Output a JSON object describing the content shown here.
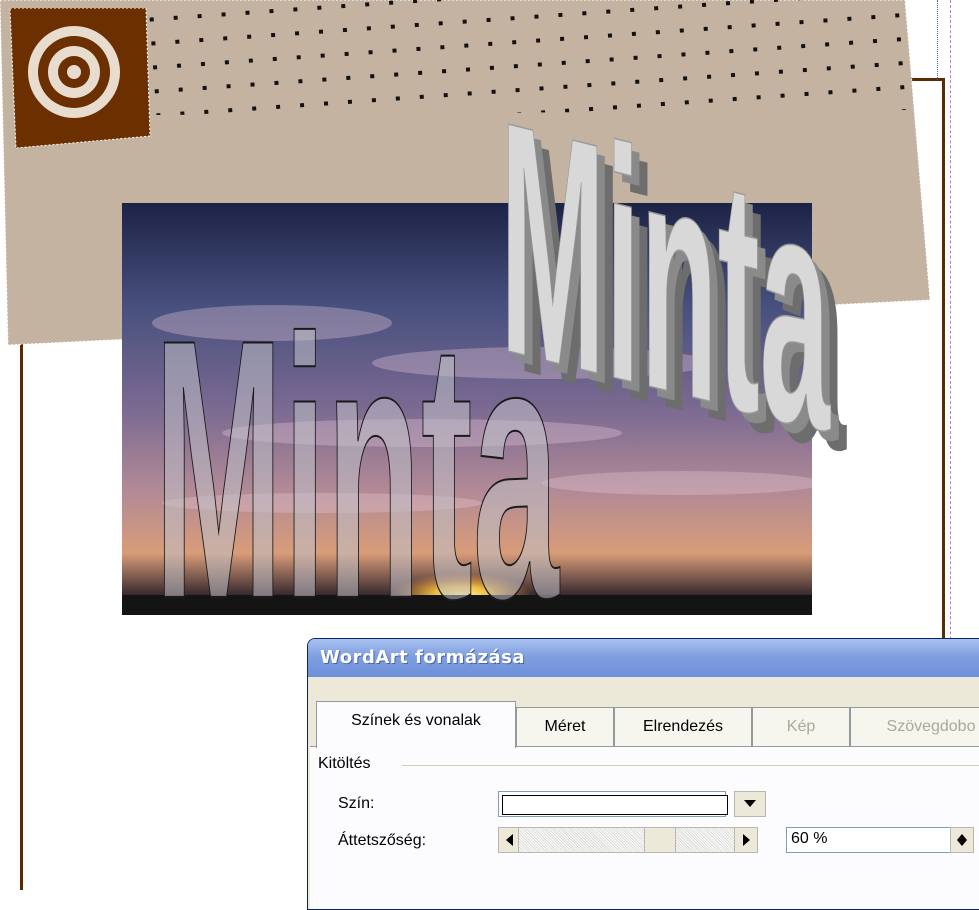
{
  "document": {
    "wordart_outline_text": "Minta",
    "wordart_3d_text": "Minta"
  },
  "dialog": {
    "title": "WordArt formázása",
    "tabs": [
      {
        "label": "Színek és vonalak",
        "active": true,
        "disabled": false
      },
      {
        "label": "Méret",
        "active": false,
        "disabled": false
      },
      {
        "label": "Elrendezés",
        "active": false,
        "disabled": false
      },
      {
        "label": "Kép",
        "active": false,
        "disabled": true
      },
      {
        "label": "Szövegdobo",
        "active": false,
        "disabled": true
      }
    ],
    "fill_group": {
      "label": "Kitöltés",
      "color_label": "Szín:",
      "color_value": "",
      "transparency_label": "Áttetszőség:",
      "transparency_value": "60 %",
      "transparency_fraction": 0.6
    }
  },
  "colors": {
    "banner_tan": "#c5b3a1",
    "brown": "#6b2f00",
    "title_bar_blue": "#7f9fe0",
    "dialog_bg": "#ece9d8"
  }
}
